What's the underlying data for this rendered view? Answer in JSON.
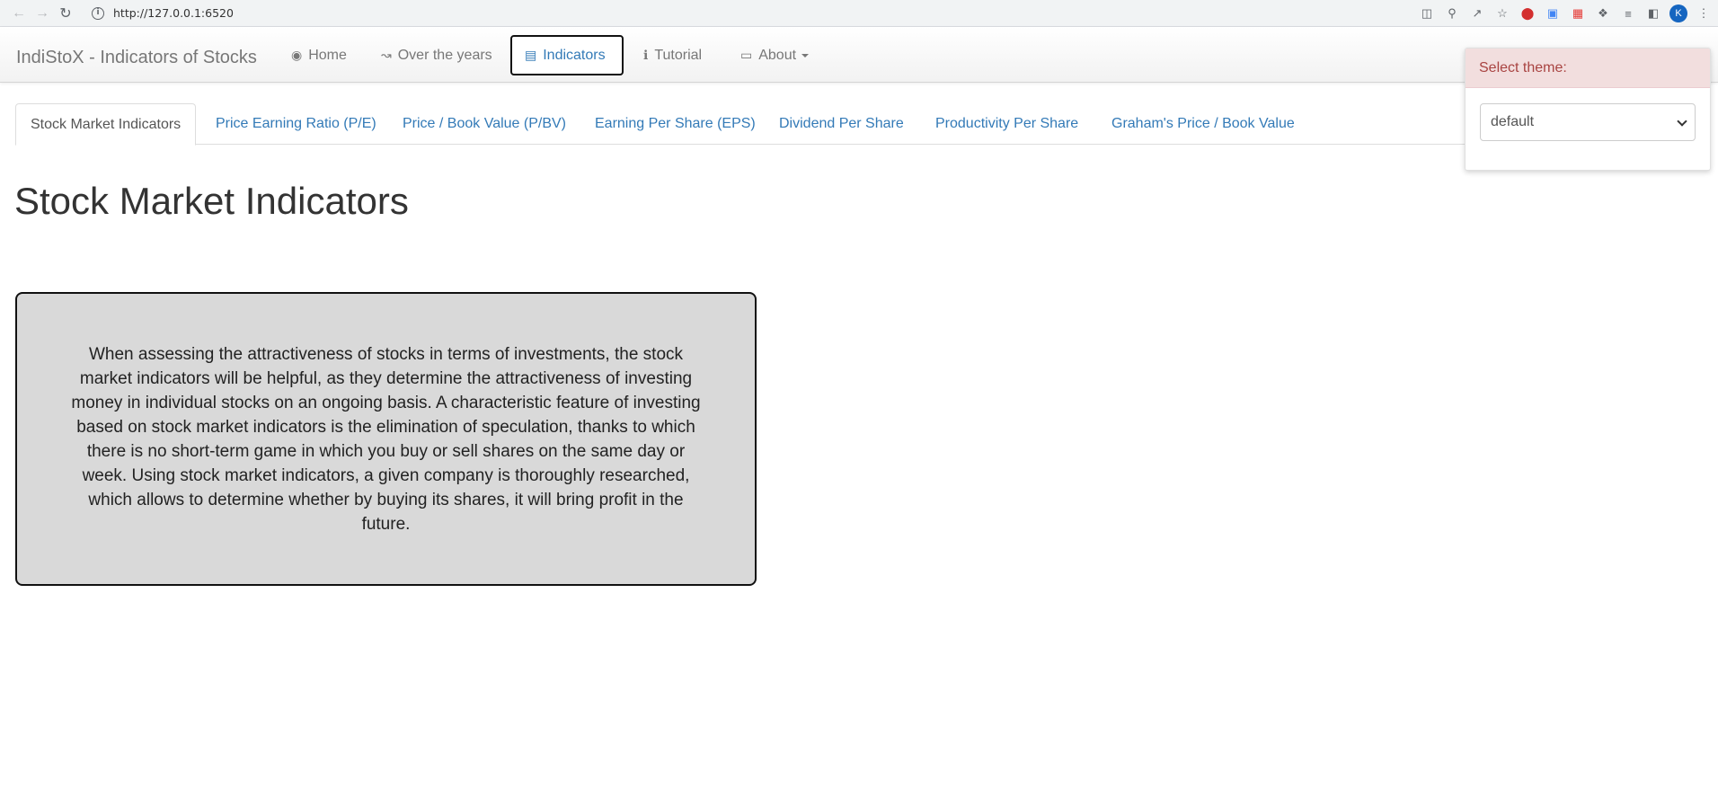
{
  "browser": {
    "url": "http://127.0.0.1:6520",
    "avatar_letter": "K"
  },
  "navbar": {
    "brand": "IndiStoX - Indicators of Stocks",
    "items": [
      {
        "label": "Home",
        "icon": "globe-icon"
      },
      {
        "label": "Over the years",
        "icon": "line-chart-icon"
      },
      {
        "label": "Indicators",
        "icon": "book-icon"
      },
      {
        "label": "Tutorial",
        "icon": "info-icon"
      },
      {
        "label": "About",
        "icon": "id-card-icon"
      }
    ]
  },
  "tabs": [
    {
      "label": "Stock Market Indicators"
    },
    {
      "label": "Price Earning Ratio (P/E)"
    },
    {
      "label": "Price / Book Value (P/BV)"
    },
    {
      "label": "Earning Per Share (EPS)"
    },
    {
      "label": "Dividend Per Share"
    },
    {
      "label": "Productivity Per Share"
    },
    {
      "label": "Graham's Price / Book Value"
    }
  ],
  "main": {
    "title": "Stock Market Indicators",
    "description": "When assessing the attractiveness of stocks in terms of investments, the stock market indicators will be helpful, as they determine the attractiveness of investing money in individual stocks on an ongoing basis. A characteristic feature of investing based on stock market indicators is the elimination of speculation, thanks to which there is no short-term game in which you buy or sell shares on the same day or week. Using stock market indicators, a given company is thoroughly researched, which allows to determine whether by buying its shares, it will bring profit in the future."
  },
  "theme": {
    "header": "Select theme:",
    "selected": "default"
  },
  "colors": {
    "link": "#337ab7",
    "alert_bg": "#f2dede",
    "alert_text": "#a94442"
  }
}
